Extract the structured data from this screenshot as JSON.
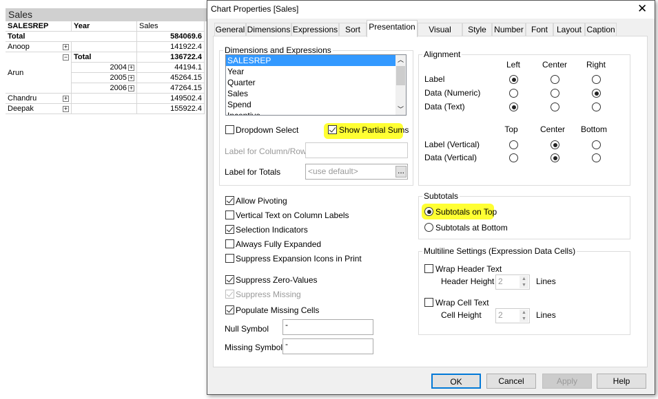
{
  "pivot": {
    "title": "Sales",
    "headers": [
      "SALESREP",
      "Year",
      "Sales"
    ],
    "rows": [
      {
        "rep": "Total",
        "year": "",
        "sales": "584069.6"
      },
      {
        "rep": "Anoop",
        "year": "",
        "sales": "141922.4"
      },
      {
        "rep": "Arun",
        "year": "Total",
        "sales": "136722.4"
      },
      {
        "rep": "",
        "year": "2004",
        "sales": "44194.1"
      },
      {
        "rep": "",
        "year": "2005",
        "sales": "45264.15"
      },
      {
        "rep": "",
        "year": "2006",
        "sales": "47264.15"
      },
      {
        "rep": "Chandru",
        "year": "",
        "sales": "149502.4"
      },
      {
        "rep": "Deepak",
        "year": "",
        "sales": "155922.4"
      }
    ]
  },
  "dialog": {
    "title": "Chart Properties [Sales]",
    "tabs": [
      "General",
      "Dimensions",
      "Expressions",
      "Sort",
      "Presentation",
      "Visual Cues",
      "Style",
      "Number",
      "Font",
      "Layout",
      "Caption"
    ],
    "active_tab": "Presentation",
    "dims": {
      "label": "Dimensions and Expressions",
      "items": [
        "SALESREP",
        "Year",
        "Quarter",
        "Sales",
        "Spend",
        "Incentive"
      ],
      "selected": "SALESREP",
      "dropdown_select": {
        "label": "Dropdown Select",
        "checked": false
      },
      "show_partial_sums": {
        "label": "Show Partial Sums",
        "checked": true
      },
      "label_col_row": "Label for Column/Row",
      "label_col_row_value": "",
      "label_totals": "Label for Totals",
      "label_totals_placeholder": "<use default>",
      "browse": "..."
    },
    "alignment": {
      "label": "Alignment",
      "h_cols": [
        "Left",
        "Center",
        "Right"
      ],
      "v_cols": [
        "Top",
        "Center",
        "Bottom"
      ],
      "h_rows": [
        {
          "label": "Label",
          "value": "Left"
        },
        {
          "label": "Data (Numeric)",
          "value": "Right"
        },
        {
          "label": "Data (Text)",
          "value": "Left"
        }
      ],
      "v_rows": [
        {
          "label": "Label (Vertical)",
          "value": "Center"
        },
        {
          "label": "Data (Vertical)",
          "value": "Center"
        }
      ]
    },
    "options": [
      {
        "label": "Allow Pivoting",
        "checked": true
      },
      {
        "label": "Vertical Text on Column Labels",
        "checked": false
      },
      {
        "label": "Selection Indicators",
        "checked": true
      },
      {
        "label": "Always Fully Expanded",
        "checked": false
      },
      {
        "label": "Suppress Expansion Icons in Print",
        "checked": false
      },
      {
        "label": "Suppress Zero-Values",
        "checked": true
      },
      {
        "label": "Suppress Missing",
        "checked": true,
        "disabled": true
      },
      {
        "label": "Populate Missing Cells",
        "checked": true
      }
    ],
    "null_symbol": {
      "label": "Null Symbol",
      "value": "-"
    },
    "missing_symbol": {
      "label": "Missing Symbol",
      "value": "-"
    },
    "subtotals": {
      "label": "Subtotals",
      "on_top": "Subtotals on Top",
      "at_bottom": "Subtotals at Bottom",
      "selected": "Subtotals on Top"
    },
    "multiline": {
      "label": "Multiline Settings (Expression Data Cells)",
      "wrap_header": {
        "label": "Wrap Header Text",
        "checked": false
      },
      "header_height": {
        "label": "Header Height",
        "value": "2",
        "unit": "Lines"
      },
      "wrap_cell": {
        "label": "Wrap Cell Text",
        "checked": false
      },
      "cell_height": {
        "label": "Cell Height",
        "value": "2",
        "unit": "Lines"
      }
    },
    "buttons": {
      "ok": "OK",
      "cancel": "Cancel",
      "apply": "Apply",
      "help": "Help"
    },
    "close_icon": "close-icon",
    "highlight_color": "#ffff33"
  }
}
